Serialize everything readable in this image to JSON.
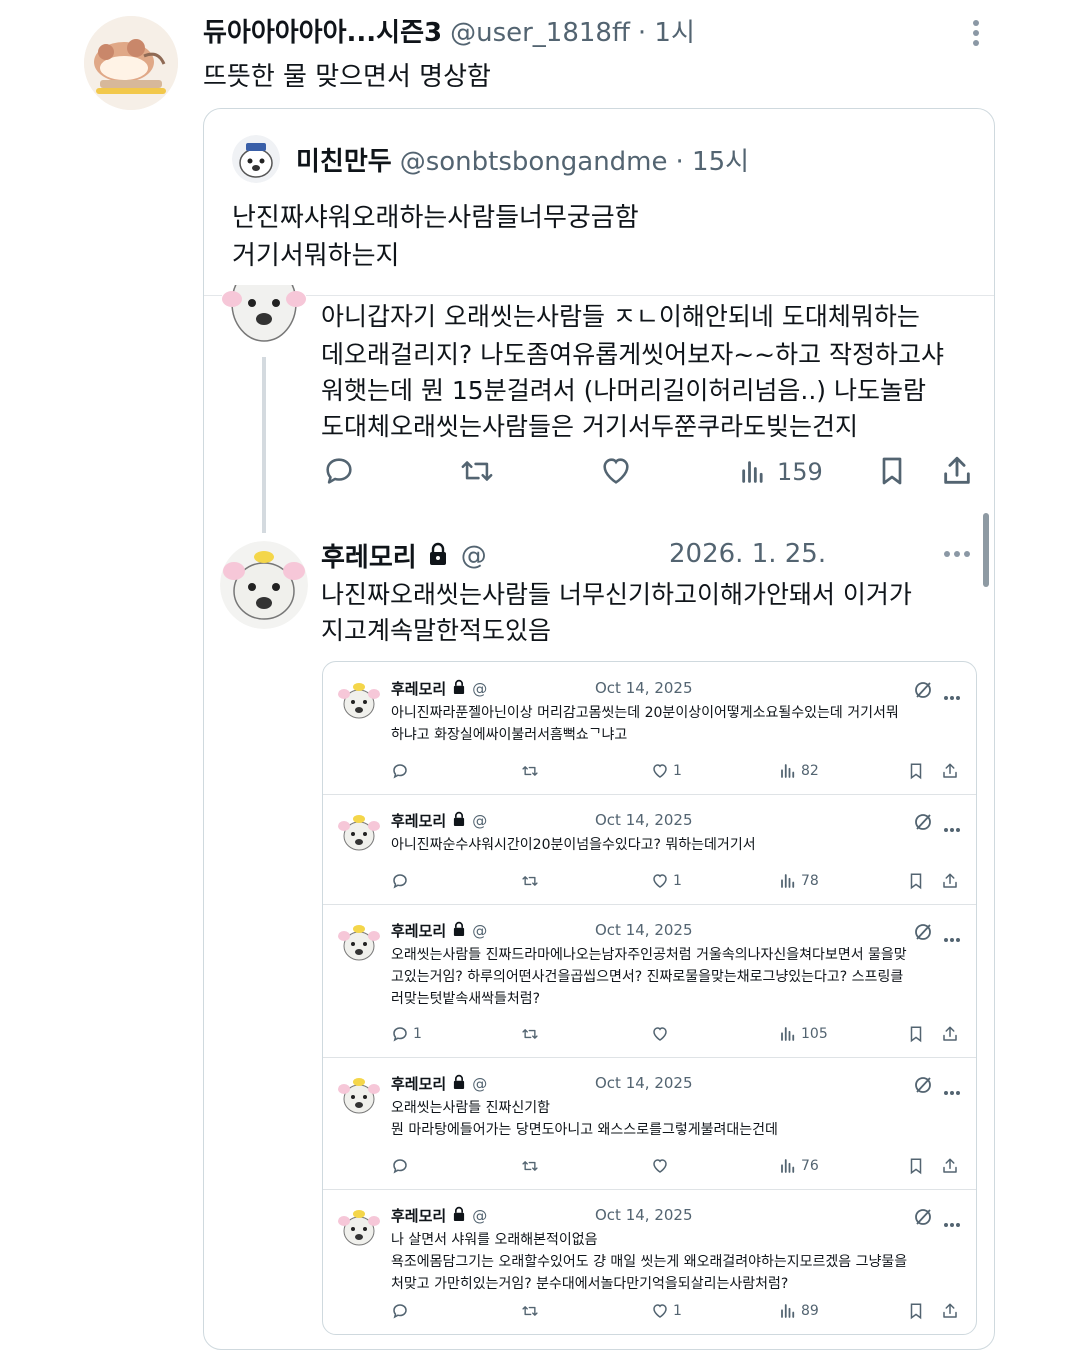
{
  "main_post": {
    "display_name": "듀아아아아아...시즌3",
    "handle": "@user_1818ff",
    "time": "· 1시",
    "text": "뜨뜻한 물 맞으면서 명상함"
  },
  "quoted_post": {
    "display_name": "미친만두",
    "handle": "@sonbtsbongandme",
    "time": "· 15시",
    "text_lines": [
      "난진짜샤워오래하는사람들너무궁금함",
      "거기서뭐하는지"
    ]
  },
  "thread_post": {
    "text_lines": [
      "아니갑자기 오래씻는사람들 ㅈㄴ이해안되네 도대체뭐하는",
      "데오래걸리지? 나도좀여유롭게씻어보자~~하고 작정하고샤",
      "워햇는데 뭔 15분걸려서 (나머리길이허리넘음..) 나도놀람",
      "도대체오래씻는사람들은 거기서두쭌쿠라도빚는건지"
    ],
    "views": "159"
  },
  "reply_post": {
    "display_name": "후레모리",
    "handle": "@",
    "date": "2026. 1. 25.",
    "text_lines": [
      "나진짜오래씻는사람들 너무신기하고이해가안돼서 이거가",
      "지고계속말한적도있음"
    ]
  },
  "embedded_posts": [
    {
      "name": "후레모리",
      "handle": "@",
      "date": "Oct 14, 2025",
      "text_lines": [
        "아니진짜라푼젤아닌이상 머리감고몸씻는데 20분이상이어떻게소요될수있는데 거기서뭐",
        "하냐고 화장실에싸이불러서흠뻑쇼ᄀ냐고"
      ],
      "replies": "",
      "likes": "1",
      "views": "82"
    },
    {
      "name": "후레모리",
      "handle": "@",
      "date": "Oct 14, 2025",
      "text_lines": [
        "아니진짜순수샤워시간이20분이넘을수있다고? 뭐하는데거기서"
      ],
      "replies": "",
      "likes": "1",
      "views": "78"
    },
    {
      "name": "후레모리",
      "handle": "@",
      "date": "Oct 14, 2025",
      "text_lines": [
        "오래씻는사람들 진짜드라마에나오는남자주인공처럼 거울속의나자신을쳐다보면서 물을맞",
        "고있는거임? 하루의어떤사건을곱씹으면서? 진짜로물을맞는채로그냥있는다고? 스프링클",
        "러맞는텃밭속새싹들처럼?"
      ],
      "replies": "1",
      "likes": "",
      "views": "105"
    },
    {
      "name": "후레모리",
      "handle": "@",
      "date": "Oct 14, 2025",
      "text_lines": [
        "오래씻는사람들 진짜신기함",
        "뭔 마라탕에들어가는 당면도아니고 왜스스로를그렇게불려대는건데"
      ],
      "replies": "",
      "likes": "",
      "views": "76"
    },
    {
      "name": "후레모리",
      "handle": "@",
      "date": "Oct 14, 2025",
      "text_lines": [
        "나 살면서 샤워를 오래해본적이없음",
        "욕조에몸담그기는 오래할수있어도 걍 매일 씻는게 왜오래걸려야하는지모르겠음 그냥물을",
        "처맞고 가만히있는거임? 분수대에서놀다만기억을되살리는사람처럼?"
      ],
      "replies": "",
      "likes": "1",
      "views": "89"
    }
  ]
}
